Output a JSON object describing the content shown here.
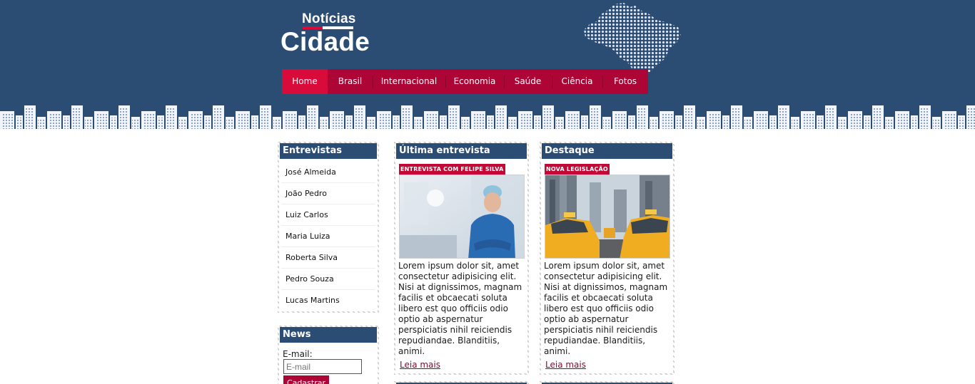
{
  "logo": {
    "small": "Notícias",
    "big": "Cidade"
  },
  "nav": [
    {
      "label": "Home",
      "active": true
    },
    {
      "label": "Brasil"
    },
    {
      "label": "Internacional"
    },
    {
      "label": "Economia"
    },
    {
      "label": "Saúde"
    },
    {
      "label": "Ciência"
    },
    {
      "label": "Fotos"
    }
  ],
  "sidebar": {
    "title": "Entrevistas",
    "items": [
      "José Almeida",
      "João Pedro",
      "Luiz Carlos",
      "Maria Luiza",
      "Roberta Silva",
      "Pedro Souza",
      "Lucas Martins"
    ]
  },
  "news": {
    "title": "News",
    "email_label": "E-mail:",
    "email_placeholder": "E-mail",
    "submit_label": "Cadastrar"
  },
  "articles": [
    {
      "section": "Última entrevista",
      "tag": "ENTREVISTA COM FELIPE SILVA",
      "body": "Lorem ipsum dolor sit, amet consectetur adipisicing elit. Nisi at dignissimos, magnam facilis et obcaecati soluta libero est quo officiis odio optio ab aspernatur perspiciatis nihil reiciendis repudiandae. Blanditiis, animi.",
      "more": "Leia mais"
    },
    {
      "section": "Destaque",
      "tag": "NOVA LEGISLAÇÃO",
      "body": "Lorem ipsum dolor sit, amet consectetur adipisicing elit. Nisi at dignissimos, magnam facilis et obcaecati soluta libero est quo officiis odio optio ab aspernatur perspiciatis nihil reiciendis repudiandae. Blanditiis, animi.",
      "more": "Leia mais"
    }
  ],
  "colors": {
    "header": "#2c4d73",
    "accent": "#ad0535",
    "accent_active": "#d80b3a"
  }
}
